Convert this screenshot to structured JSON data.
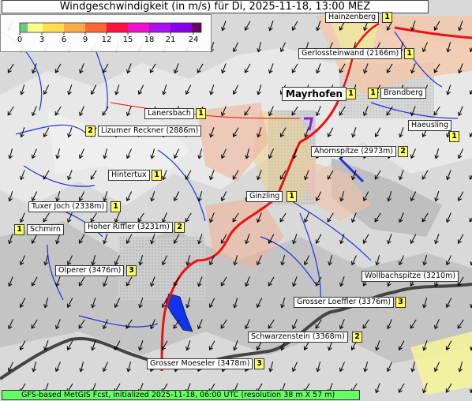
{
  "title": "Windgeschwindigkeit (in m/s) für Di, 2025-11-18, 13:00 MEZ",
  "legend": {
    "ticks": [
      "0",
      "3",
      "6",
      "9",
      "12",
      "15",
      "18",
      "21",
      "24"
    ],
    "colors": [
      "#66cc88",
      "#ffff88",
      "#ffe060",
      "#ffaa44",
      "#ff6633",
      "#ff1144",
      "#cc22cc",
      "#9900ff",
      "#660066"
    ]
  },
  "places": [
    {
      "name": "Hainzenberg",
      "badge": "1"
    },
    {
      "name": "Gerlossteinwand (2166m)",
      "badge": "1"
    },
    {
      "name": "Mayrhofen",
      "badge": "1"
    },
    {
      "name": "Brandberg",
      "badge": "1"
    },
    {
      "name": "Lanersbach",
      "badge": "1"
    },
    {
      "name": "Lizumer Reckner (2886m)",
      "badge": "2"
    },
    {
      "name": "Haeusling",
      "badge": "1"
    },
    {
      "name": "Ahornspitze (2973m)",
      "badge": "2"
    },
    {
      "name": "Hintertux",
      "badge": "1"
    },
    {
      "name": "Ginzling",
      "badge": "1"
    },
    {
      "name": "Tuxer Joch (2338m)",
      "badge": "1"
    },
    {
      "name": "Schmirn",
      "badge": "1"
    },
    {
      "name": "Hoher Riffler (3231m)",
      "badge": "2"
    },
    {
      "name": "Olperer (3476m)",
      "badge": "3"
    },
    {
      "name": "Wollbachspitze (3210m)",
      "badge": ""
    },
    {
      "name": "Grosser Loeffler (3376m)",
      "badge": "3"
    },
    {
      "name": "Schwarzenstein (3368m)",
      "badge": "2"
    },
    {
      "name": "Grosser Moeseler (3478m)",
      "badge": "3"
    }
  ],
  "footer": "GFS-based MetGIS Fcst, initialized 2025-11-18, 06:00 UTC  (resolution 38 m X 57 m)"
}
